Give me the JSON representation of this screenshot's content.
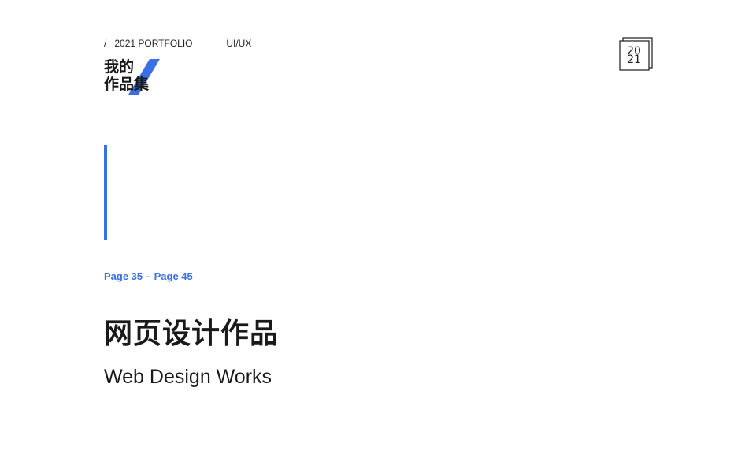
{
  "header": {
    "slash": "/",
    "portfolio": "2021 PORTFOLIO",
    "category": "UI/UX"
  },
  "logo": {
    "line1": "我的",
    "line2": "作品集"
  },
  "badge": {
    "year_top": "20",
    "year_bottom": "21"
  },
  "section": {
    "page_range": "Page 35 – Page 45",
    "title_cn": "网页设计作品",
    "title_en": "Web Design Works"
  },
  "colors": {
    "accent": "#3b6fe6",
    "text": "#1a1a1a",
    "background": "#ffffff"
  }
}
